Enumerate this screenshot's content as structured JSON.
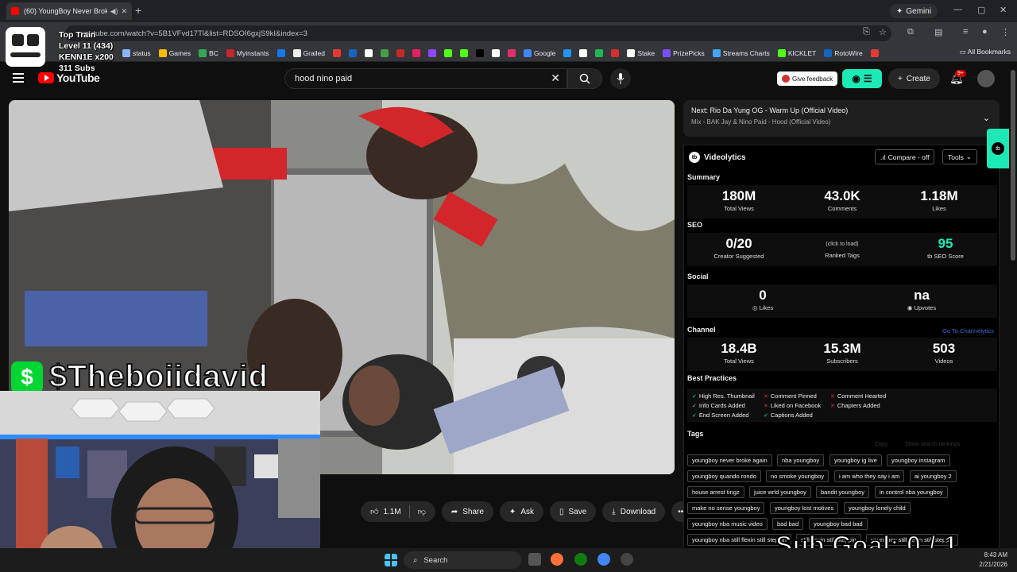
{
  "browser": {
    "tab_title": "(60) YoungBoy Never Broke",
    "url": "youtube.com/watch?v=5B1VFvd17Tl&list=RDSOI6gxjS9kI&index=3",
    "gemini_label": "Gemini",
    "bookmarks": [
      {
        "label": "status",
        "color": "#8ab4f8"
      },
      {
        "label": "Games",
        "color": "#fbbc04"
      },
      {
        "label": "BC",
        "color": "#34a853"
      },
      {
        "label": "Myinstants",
        "color": "#c62828"
      },
      {
        "label": "",
        "color": "#1877f2"
      },
      {
        "label": "Grailed",
        "color": "#eeeeee"
      },
      {
        "label": "",
        "color": "#e53935"
      },
      {
        "label": "",
        "color": "#1565c0"
      },
      {
        "label": "",
        "color": "#ffffff"
      },
      {
        "label": "",
        "color": "#43a047"
      },
      {
        "label": "",
        "color": "#c62828"
      },
      {
        "label": "",
        "color": "#e91e63"
      },
      {
        "label": "",
        "color": "#9146ff"
      },
      {
        "label": "",
        "color": "#53fc18"
      },
      {
        "label": "",
        "color": "#53fc18"
      },
      {
        "label": "",
        "color": "#000000"
      },
      {
        "label": "",
        "color": "#ffffff"
      },
      {
        "label": "",
        "color": "#e1306c"
      },
      {
        "label": "Google",
        "color": "#4285f4"
      },
      {
        "label": "",
        "color": "#2196f3"
      },
      {
        "label": "",
        "color": "#ffffff"
      },
      {
        "label": "",
        "color": "#1db954"
      },
      {
        "label": "",
        "color": "#d32f2f"
      },
      {
        "label": "Stake",
        "color": "#ffffff"
      },
      {
        "label": "PrizePicks",
        "color": "#7c4dff"
      },
      {
        "label": "Streams Charts",
        "color": "#42a5f5"
      },
      {
        "label": "KICKLET",
        "color": "#53fc18"
      },
      {
        "label": "RotoWire",
        "color": "#1565c0"
      },
      {
        "label": "",
        "color": "#e53935"
      }
    ],
    "all_bookmarks": "All Bookmarks"
  },
  "stream_overlay": {
    "line1": "Top Train",
    "line2": "Level 11  (434)",
    "line3": "KENN1E x200",
    "line4": "311 Subs",
    "cashtag": "$Theboiidavid",
    "cash_icon": "$",
    "sub_goal": "Sub Goal:  0 / 1"
  },
  "youtube": {
    "logo_text": "YouTube",
    "search_value": "hood nino paid",
    "feedback_label": "Give feedback",
    "create_label": "Create",
    "notif_badge": "9+",
    "actions": {
      "likes": "1.1M",
      "share": "Share",
      "ask": "Ask",
      "save": "Save",
      "download": "Download"
    },
    "next_card": {
      "title": "Next: Rio Da Yung OG - Warm Up (Official Video)",
      "subtitle": "Mix - BAK Jay & Nino Paid - Hood (Official Video)"
    }
  },
  "videolytics": {
    "brand": "Videolytics",
    "compare_label": "Compare - off",
    "tools_label": "Tools",
    "summary_label": "Summary",
    "summary": [
      {
        "value": "180M",
        "label": "Total Views"
      },
      {
        "value": "43.0K",
        "label": "Comments"
      },
      {
        "value": "1.18M",
        "label": "Likes"
      }
    ],
    "seo_label": "SEO",
    "seo": [
      {
        "value": "0/20",
        "label": "Creator Suggested"
      },
      {
        "value": "(click to load)",
        "label": "Ranked Tags"
      },
      {
        "value": "95",
        "label": "SEO Score"
      }
    ],
    "social_label": "Social",
    "social": [
      {
        "value": "0",
        "label": "Likes"
      },
      {
        "value": "na",
        "label": "Upvotes"
      }
    ],
    "channel_label": "Channel",
    "channel_link": "Go To Channelytics",
    "channel": [
      {
        "value": "18.4B",
        "label": "Total Views"
      },
      {
        "value": "15.3M",
        "label": "Subscribers"
      },
      {
        "value": "503",
        "label": "Videos"
      }
    ],
    "best_practices_label": "Best Practices",
    "best_practices": [
      {
        "label": "High Res. Thumbnail",
        "ok": true
      },
      {
        "label": "Comment Pinned",
        "ok": false
      },
      {
        "label": "Comment Hearted",
        "ok": false
      },
      {
        "label": "Info Cards Added",
        "ok": true
      },
      {
        "label": "Liked on Facebook",
        "ok": false
      },
      {
        "label": "Chapters Added",
        "ok": false
      },
      {
        "label": "End Screen Added",
        "ok": true
      },
      {
        "label": "Captions Added",
        "ok": true
      }
    ],
    "tags_label": "Tags",
    "tags_copy": "Copy",
    "tags_show": "Show search rankings",
    "tags": [
      "youngboy never broke again",
      "nba youngboy",
      "youngboy ig live",
      "youngboy instagram",
      "youngboy quando rondo",
      "no smoke youngboy",
      "i am who they say i am",
      "ai youngboy 2",
      "house arrest tingz",
      "juice wrld youngboy",
      "bandit youngboy",
      "in control nba youngboy",
      "make no sense youngboy",
      "youngboy lost motives",
      "youngboy lonely child",
      "youngboy nba music video",
      "bad bad",
      "youngboy bad bad",
      "youngboy nba still flexin still steppin",
      "still flexin still steppin",
      "youngboy still flexin still steppin"
    ]
  },
  "taskbar": {
    "search_label": "Search",
    "time": "8:43 AM",
    "date": "2/21/2026"
  }
}
